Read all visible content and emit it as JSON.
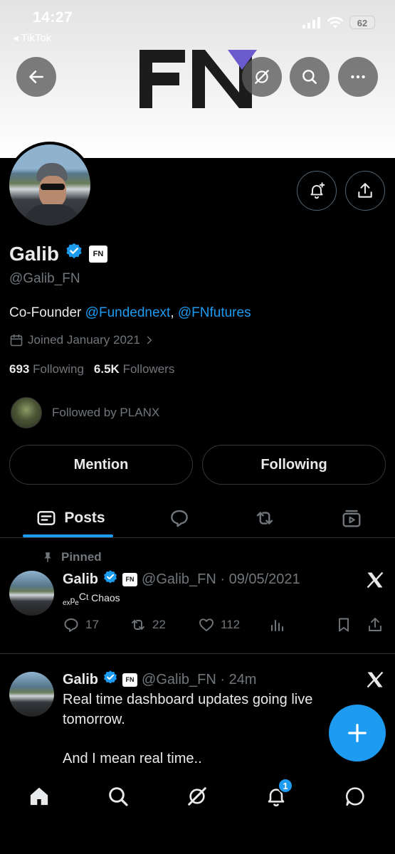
{
  "status_bar": {
    "time": "14:27",
    "back_app": "◂ TikTok",
    "battery": "62"
  },
  "profile": {
    "name": "Galib",
    "fn_badge": "FN",
    "handle": "@Galib_FN",
    "bio_prefix": "Co-Founder ",
    "bio_link1": "@Fundednext",
    "bio_sep": ", ",
    "bio_link2": "@FNfutures",
    "joined": "Joined January 2021",
    "following_count": "693",
    "following_label": "Following",
    "followers_count": "6.5K",
    "followers_label": "Followers",
    "followed_by": "Followed by PLANX"
  },
  "buttons": {
    "mention": "Mention",
    "following": "Following"
  },
  "tabs": {
    "posts": "Posts"
  },
  "posts": [
    {
      "pinned_label": "Pinned",
      "name": "Galib",
      "fn_badge": "FN",
      "meta": "@Galib_FN · 09/05/2021",
      "replies": "17",
      "reposts": "22",
      "likes": "112"
    },
    {
      "name": "Galib",
      "fn_badge": "FN",
      "meta": "@Galib_FN · 24m",
      "text_line1": "Real time dashboard updates going live",
      "text_line2": "tomorrow.",
      "text_line3": "And I mean real time.."
    }
  ],
  "chaos": {
    "ex": "ex",
    "p": "p",
    "e": "e",
    "C": "C",
    "t": "t",
    "Chaos": "Chaos"
  },
  "nav": {
    "notif_count": "1"
  },
  "colors": {
    "accent": "#1d9bf0",
    "background": "#000000",
    "muted": "#71767b"
  }
}
